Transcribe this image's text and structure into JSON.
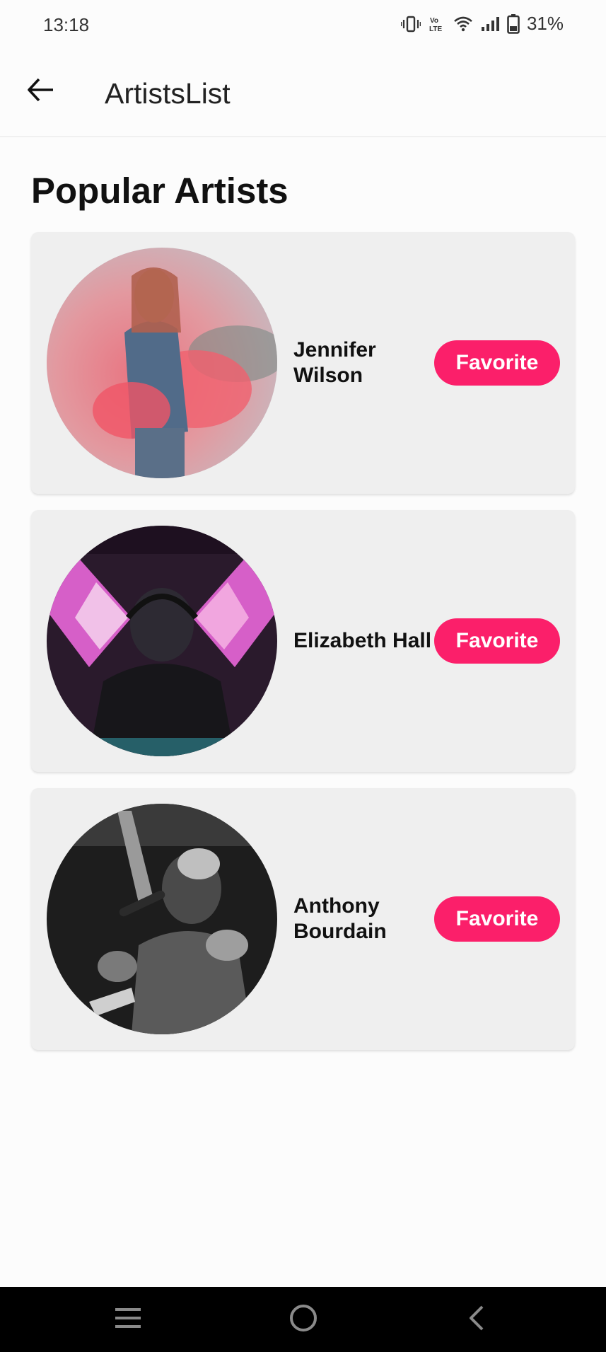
{
  "status_bar": {
    "time": "13:18",
    "battery": "31%",
    "icons": [
      "vibrate-icon",
      "volte-icon",
      "wifi-icon",
      "signal-icon",
      "battery-icon"
    ]
  },
  "app_bar": {
    "back_icon": "arrow-left-icon",
    "title": "ArtistsList"
  },
  "main": {
    "section_title": "Popular Artists",
    "artists": [
      {
        "name_line1": "Jennifer",
        "name_line2": "Wilson",
        "button": "Favorite"
      },
      {
        "name_line1": "Elizabeth Hall",
        "name_line2": "",
        "button": "Favorite"
      },
      {
        "name_line1": "Anthony",
        "name_line2": "Bourdain",
        "button": "Favorite"
      }
    ]
  },
  "nav_bar": {
    "icons": [
      "menu-icon",
      "home-icon",
      "back-icon"
    ]
  },
  "colors": {
    "accent": "#fb1f6a",
    "card_bg": "#efefef",
    "nav_bg": "#000000"
  }
}
